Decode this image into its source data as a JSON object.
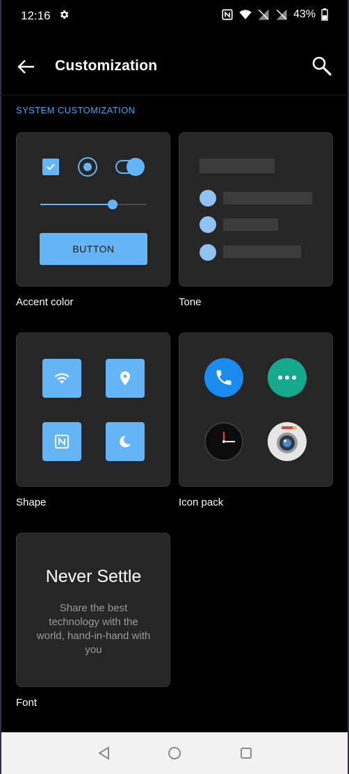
{
  "status_bar": {
    "time": "12:16",
    "battery": "43%",
    "icons": [
      "settings-icon",
      "nfc-icon",
      "wifi-icon",
      "no-signal-icon",
      "no-signal-icon",
      "battery-icon"
    ]
  },
  "toolbar": {
    "title": "Customization",
    "back_icon": "arrow-left-icon",
    "search_icon": "search-icon"
  },
  "section": {
    "header": "SYSTEM CUSTOMIZATION"
  },
  "cards": {
    "accent": {
      "label": "Accent color",
      "button_label": "BUTTON"
    },
    "tone": {
      "label": "Tone"
    },
    "shape": {
      "label": "Shape",
      "tiles": [
        "wifi-icon",
        "location-icon",
        "nfc-icon",
        "moon-icon"
      ]
    },
    "icon_pack": {
      "label": "Icon pack",
      "icons": [
        "phone-icon",
        "messages-icon",
        "clock-icon",
        "camera-icon"
      ]
    },
    "font": {
      "label": "Font",
      "heading": "Never Settle",
      "body": "Share the best technology with the world, hand-in-hand with you"
    }
  },
  "nav_bar": {
    "icons": [
      "back-triangle-icon",
      "home-circle-icon",
      "recents-square-icon"
    ]
  },
  "colors": {
    "accent": "#64b5f6",
    "section_header": "#4aa3ee",
    "card_bg": "#262626",
    "background": "#000000"
  }
}
